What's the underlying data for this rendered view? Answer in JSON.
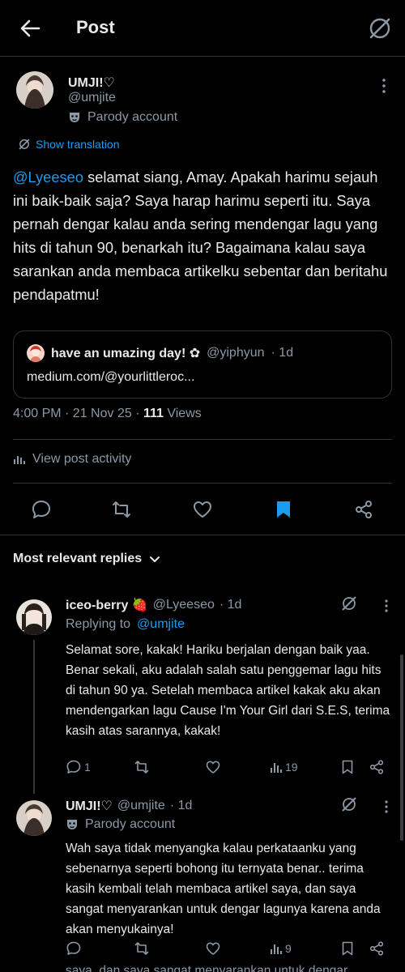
{
  "header": {
    "title": "Post"
  },
  "post": {
    "author_name": "UMJI!♡",
    "author_handle": "@umjite",
    "parody_label": "Parody account",
    "show_translation": "Show translation",
    "mention": "@Lyeeseo",
    "body": " selamat siang, Amay. Apakah harimu sejauh ini baik-baik saja? Saya harap harimu seperti itu. Saya pernah dengar kalau anda sering mendengar lagu yang hits di tahun 90, benarkah itu? Bagaimana kalau saya sarankan anda membaca artikelku sebentar dan beritahu pendapatmu!",
    "quote": {
      "name": "have an umazing day! ✿",
      "handle": "@yiphyun",
      "time": "· 1d",
      "link": "medium.com/@yourlittleroc..."
    },
    "timestamp": "4:00 PM · 21 Nov 25 · ",
    "views_count": "111",
    "views_label": " Views",
    "view_activity": "View post activity"
  },
  "replies_header": {
    "sort_label": "Most relevant replies"
  },
  "replies": [
    {
      "name": "iceo-berry 🍓",
      "handle": "@Lyeeseo",
      "time": "· 1d",
      "replying_prefix": "Replying to",
      "replying_to": "@umjite",
      "body": "Selamat sore, kakak! Hariku berjalan dengan baik yaa. Benar sekali, aku adalah salah satu penggemar lagu hits di tahun 90 ya. Setelah membaca artikel kakak aku akan mendengarkan lagu Cause I'm Your Girl dari S.E.S, terima kasih atas sarannya, kakak!",
      "reply_count": "1",
      "views_count": "19"
    },
    {
      "name": "UMJI!♡",
      "handle": "@umjite",
      "time": "· 1d",
      "parody_label": "Parody account",
      "body": "Wah saya tidak menyangka kalau perkataanku yang sebenarnya seperti bohong itu ternyata benar.. terima kasih kembali telah membaca artikel saya, dan saya sangat menyarankan untuk dengar lagunya karena anda akan menyukainya!",
      "reply_count": "",
      "views_count": "9"
    }
  ],
  "partial_next_line": "saya, dan saya sangat menyarankan untuk dengar...",
  "colors": {
    "background": "#000000",
    "text": "#e7e9ea",
    "muted": "#8b98a5",
    "accent": "#1d9bf0",
    "divider": "#2f3336"
  }
}
